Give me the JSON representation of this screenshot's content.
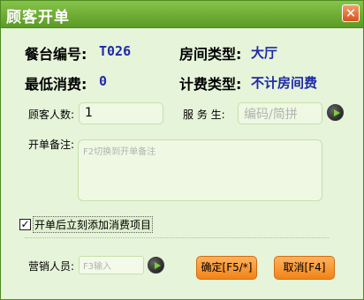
{
  "window": {
    "title": "顾客开单",
    "close_symbol": "✕"
  },
  "info": {
    "table_no_label": "餐台编号:",
    "table_no_value": "T026",
    "room_type_label": "房间类型:",
    "room_type_value": "大厅",
    "min_spend_label": "最低消费:",
    "min_spend_value": "0",
    "billing_type_label": "计费类型:",
    "billing_type_value": "不计房间费"
  },
  "form": {
    "guest_count_label": "顾客人数:",
    "guest_count_value": "1",
    "waiter_label": "服 务 生:",
    "waiter_placeholder": "编码/简拼",
    "remark_label": "开单备注:",
    "remark_placeholder": "F2切换到开单备注",
    "auto_add_label": "开单后立刻添加消费项目",
    "auto_add_checked": true,
    "sales_label": "营销人员:",
    "sales_placeholder": "F3输入"
  },
  "buttons": {
    "confirm": "确定[F5/*]",
    "cancel": "取消[F4]"
  },
  "colors": {
    "title_bar": "#6fae33",
    "value_text": "#1e2aa8",
    "button": "#f18418",
    "background": "#e6f4da"
  }
}
